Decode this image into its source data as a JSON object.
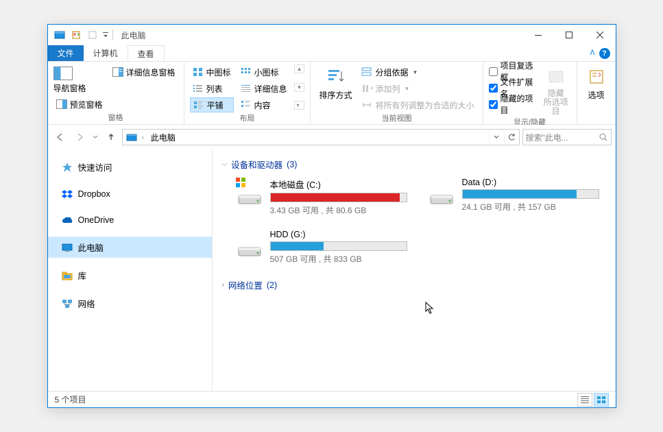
{
  "title": "此电脑",
  "tabs": {
    "file": "文件",
    "computer": "计算机",
    "view": "查看"
  },
  "ribbon": {
    "panes_label": "窗格",
    "layout_label": "布局",
    "current_view_label": "当前视图",
    "show_hide_label": "显示/隐藏",
    "nav_pane": "导航窗格",
    "preview_pane": "预览窗格",
    "details_pane": "详细信息窗格",
    "medium_icons": "中图标",
    "small_icons": "小图标",
    "list": "列表",
    "details": "详细信息",
    "tiles": "平铺",
    "content": "内容",
    "sort_by": "排序方式",
    "group_by": "分组依据",
    "add_columns": "添加列",
    "size_columns": "将所有列调整为合适的大小",
    "item_checkboxes": "项目复选框",
    "filename_ext": "文件扩展名",
    "hidden_items": "隐藏的项目",
    "hide_selected": "隐藏\n所选项目",
    "options": "选项"
  },
  "address": {
    "location": "此电脑",
    "search_placeholder": "搜索\"此电..."
  },
  "sidebar": {
    "items": [
      {
        "label": "快速访问"
      },
      {
        "label": "Dropbox"
      },
      {
        "label": "OneDrive"
      },
      {
        "label": "此电脑"
      },
      {
        "label": "库"
      },
      {
        "label": "网络"
      }
    ]
  },
  "sections": {
    "devices": {
      "label": "设备和驱动器",
      "count": "(3)"
    },
    "network": {
      "label": "网络位置",
      "count": "(2)"
    }
  },
  "drives": [
    {
      "name": "本地磁盘 (C:)",
      "stats": "3.43 GB 可用 , 共 80.6 GB",
      "fill_pct": 95,
      "color": "#da2626",
      "os": true
    },
    {
      "name": "Data (D:)",
      "stats": "24.1 GB 可用 , 共 157 GB",
      "fill_pct": 84,
      "color": "#26a0da",
      "os": false
    },
    {
      "name": "HDD (G:)",
      "stats": "507 GB 可用 , 共 833 GB",
      "fill_pct": 39,
      "color": "#26a0da",
      "os": false
    }
  ],
  "statusbar": {
    "items": "5 个项目"
  }
}
